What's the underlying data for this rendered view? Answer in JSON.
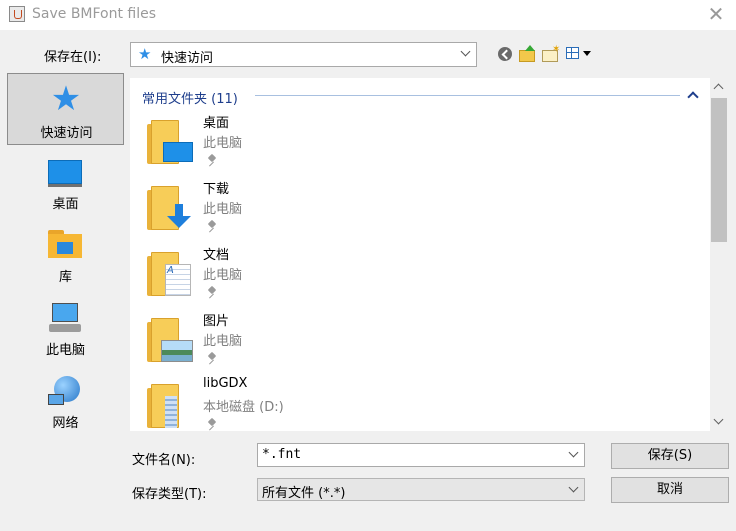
{
  "window": {
    "title": "Save BMFont files",
    "close_glyph": "✕"
  },
  "look_in": {
    "label": "保存在(I):",
    "value": "快速访问",
    "icon": "star-icon"
  },
  "toolbar": {
    "back": "back-icon",
    "up": "up-folder-icon",
    "new_folder": "new-folder-icon",
    "view_menu": "view-menu-icon"
  },
  "places": [
    {
      "label": "快速访问",
      "icon": "quick-access-star-icon",
      "selected": true
    },
    {
      "label": "桌面",
      "icon": "desktop-icon"
    },
    {
      "label": "库",
      "icon": "library-icon"
    },
    {
      "label": "此电脑",
      "icon": "this-pc-icon"
    },
    {
      "label": "网络",
      "icon": "network-icon"
    }
  ],
  "file_list": {
    "group_title": "常用文件夹 (11)",
    "items": [
      {
        "name": "桌面",
        "location": "此电脑",
        "overlay": "desktop"
      },
      {
        "name": "下载",
        "location": "此电脑",
        "overlay": "download"
      },
      {
        "name": "文档",
        "location": "此电脑",
        "overlay": "document"
      },
      {
        "name": "图片",
        "location": "此电脑",
        "overlay": "picture"
      },
      {
        "name": "libGDX",
        "location": "本地磁盘 (D:)",
        "overlay": "zip"
      }
    ]
  },
  "filename": {
    "label": "文件名(N):",
    "value": "*.fnt"
  },
  "filetype": {
    "label": "保存类型(T):",
    "value": "所有文件 (*.*)"
  },
  "buttons": {
    "save": "保存(S)",
    "cancel": "取消"
  },
  "colors": {
    "accent": "#2f8fe6",
    "group_title": "#1e3e8c",
    "folder": "#f7cd58"
  }
}
